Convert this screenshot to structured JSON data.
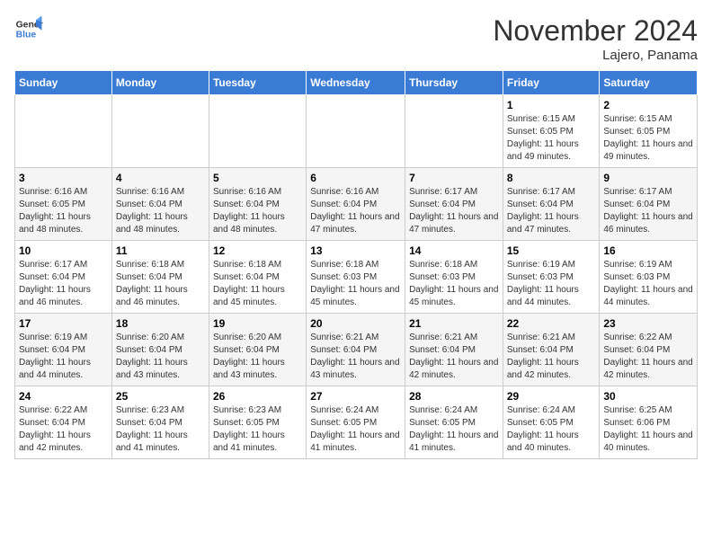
{
  "header": {
    "logo_general": "General",
    "logo_blue": "Blue",
    "month_title": "November 2024",
    "location": "Lajero, Panama"
  },
  "days_of_week": [
    "Sunday",
    "Monday",
    "Tuesday",
    "Wednesday",
    "Thursday",
    "Friday",
    "Saturday"
  ],
  "weeks": [
    [
      {
        "day": "",
        "text": ""
      },
      {
        "day": "",
        "text": ""
      },
      {
        "day": "",
        "text": ""
      },
      {
        "day": "",
        "text": ""
      },
      {
        "day": "",
        "text": ""
      },
      {
        "day": "1",
        "text": "Sunrise: 6:15 AM\nSunset: 6:05 PM\nDaylight: 11 hours and 49 minutes."
      },
      {
        "day": "2",
        "text": "Sunrise: 6:15 AM\nSunset: 6:05 PM\nDaylight: 11 hours and 49 minutes."
      }
    ],
    [
      {
        "day": "3",
        "text": "Sunrise: 6:16 AM\nSunset: 6:05 PM\nDaylight: 11 hours and 48 minutes."
      },
      {
        "day": "4",
        "text": "Sunrise: 6:16 AM\nSunset: 6:04 PM\nDaylight: 11 hours and 48 minutes."
      },
      {
        "day": "5",
        "text": "Sunrise: 6:16 AM\nSunset: 6:04 PM\nDaylight: 11 hours and 48 minutes."
      },
      {
        "day": "6",
        "text": "Sunrise: 6:16 AM\nSunset: 6:04 PM\nDaylight: 11 hours and 47 minutes."
      },
      {
        "day": "7",
        "text": "Sunrise: 6:17 AM\nSunset: 6:04 PM\nDaylight: 11 hours and 47 minutes."
      },
      {
        "day": "8",
        "text": "Sunrise: 6:17 AM\nSunset: 6:04 PM\nDaylight: 11 hours and 47 minutes."
      },
      {
        "day": "9",
        "text": "Sunrise: 6:17 AM\nSunset: 6:04 PM\nDaylight: 11 hours and 46 minutes."
      }
    ],
    [
      {
        "day": "10",
        "text": "Sunrise: 6:17 AM\nSunset: 6:04 PM\nDaylight: 11 hours and 46 minutes."
      },
      {
        "day": "11",
        "text": "Sunrise: 6:18 AM\nSunset: 6:04 PM\nDaylight: 11 hours and 46 minutes."
      },
      {
        "day": "12",
        "text": "Sunrise: 6:18 AM\nSunset: 6:04 PM\nDaylight: 11 hours and 45 minutes."
      },
      {
        "day": "13",
        "text": "Sunrise: 6:18 AM\nSunset: 6:03 PM\nDaylight: 11 hours and 45 minutes."
      },
      {
        "day": "14",
        "text": "Sunrise: 6:18 AM\nSunset: 6:03 PM\nDaylight: 11 hours and 45 minutes."
      },
      {
        "day": "15",
        "text": "Sunrise: 6:19 AM\nSunset: 6:03 PM\nDaylight: 11 hours and 44 minutes."
      },
      {
        "day": "16",
        "text": "Sunrise: 6:19 AM\nSunset: 6:03 PM\nDaylight: 11 hours and 44 minutes."
      }
    ],
    [
      {
        "day": "17",
        "text": "Sunrise: 6:19 AM\nSunset: 6:04 PM\nDaylight: 11 hours and 44 minutes."
      },
      {
        "day": "18",
        "text": "Sunrise: 6:20 AM\nSunset: 6:04 PM\nDaylight: 11 hours and 43 minutes."
      },
      {
        "day": "19",
        "text": "Sunrise: 6:20 AM\nSunset: 6:04 PM\nDaylight: 11 hours and 43 minutes."
      },
      {
        "day": "20",
        "text": "Sunrise: 6:21 AM\nSunset: 6:04 PM\nDaylight: 11 hours and 43 minutes."
      },
      {
        "day": "21",
        "text": "Sunrise: 6:21 AM\nSunset: 6:04 PM\nDaylight: 11 hours and 42 minutes."
      },
      {
        "day": "22",
        "text": "Sunrise: 6:21 AM\nSunset: 6:04 PM\nDaylight: 11 hours and 42 minutes."
      },
      {
        "day": "23",
        "text": "Sunrise: 6:22 AM\nSunset: 6:04 PM\nDaylight: 11 hours and 42 minutes."
      }
    ],
    [
      {
        "day": "24",
        "text": "Sunrise: 6:22 AM\nSunset: 6:04 PM\nDaylight: 11 hours and 42 minutes."
      },
      {
        "day": "25",
        "text": "Sunrise: 6:23 AM\nSunset: 6:04 PM\nDaylight: 11 hours and 41 minutes."
      },
      {
        "day": "26",
        "text": "Sunrise: 6:23 AM\nSunset: 6:05 PM\nDaylight: 11 hours and 41 minutes."
      },
      {
        "day": "27",
        "text": "Sunrise: 6:24 AM\nSunset: 6:05 PM\nDaylight: 11 hours and 41 minutes."
      },
      {
        "day": "28",
        "text": "Sunrise: 6:24 AM\nSunset: 6:05 PM\nDaylight: 11 hours and 41 minutes."
      },
      {
        "day": "29",
        "text": "Sunrise: 6:24 AM\nSunset: 6:05 PM\nDaylight: 11 hours and 40 minutes."
      },
      {
        "day": "30",
        "text": "Sunrise: 6:25 AM\nSunset: 6:06 PM\nDaylight: 11 hours and 40 minutes."
      }
    ]
  ]
}
